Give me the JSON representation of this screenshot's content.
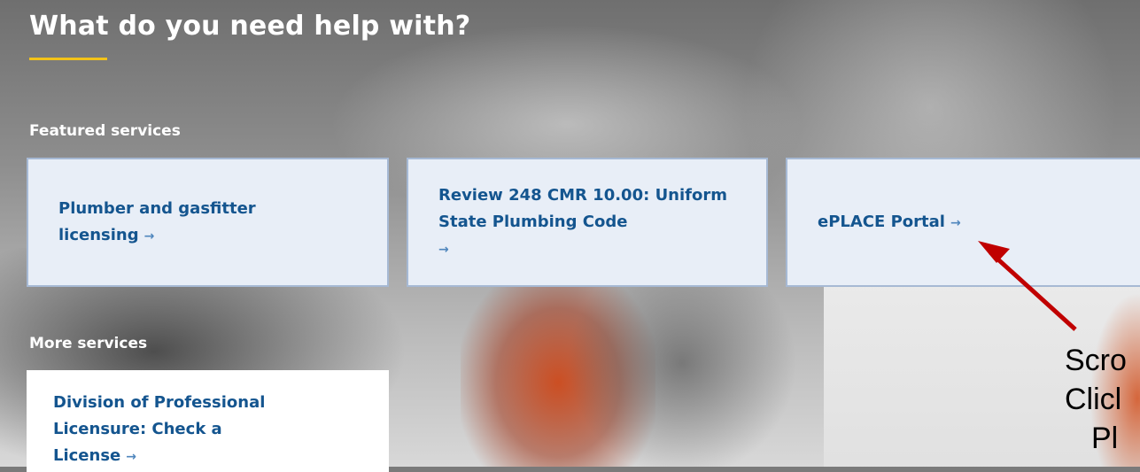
{
  "heading": "What do you need help with?",
  "featured": {
    "label": "Featured services",
    "cards": [
      {
        "text": "Plumber and gasfitter licensing"
      },
      {
        "text": "Review 248 CMR 10.00: Uniform State Plumbing Code"
      },
      {
        "text": "ePLACE Portal"
      }
    ]
  },
  "more": {
    "label": "More services",
    "cards": [
      {
        "text": "Division of Professional Licensure: Check a License"
      }
    ]
  },
  "annotation": {
    "line1": "Scro",
    "line2": "Clicl",
    "line3": "Pl",
    "color": "#c00000"
  },
  "icons": {
    "link_arrow": "→"
  },
  "colors": {
    "link": "#14558f",
    "card_bg": "#e8eef7",
    "card_border": "#a6b9d4",
    "accent_gold": "#f3c319"
  }
}
